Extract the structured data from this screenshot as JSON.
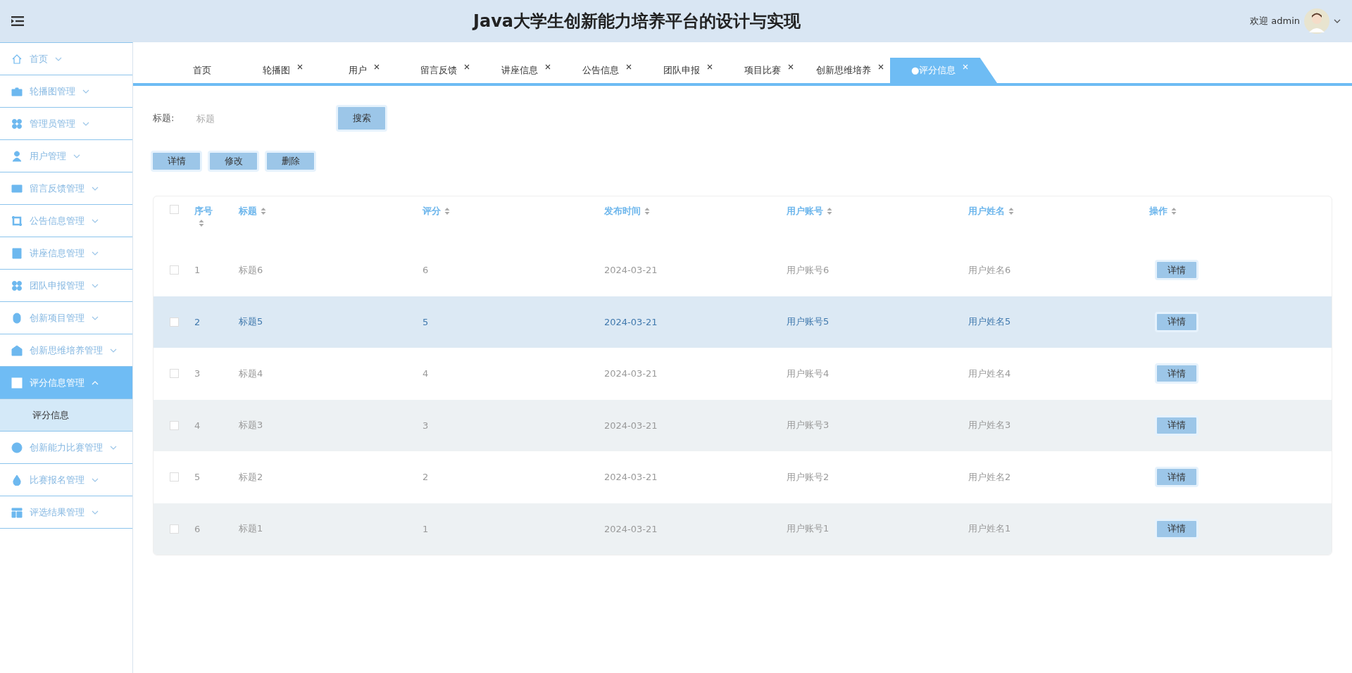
{
  "header": {
    "title": "Java大学生创新能力培养平台的设计与实现",
    "welcome": "欢迎 admin"
  },
  "sidebar": {
    "items": [
      {
        "label": "首页",
        "expanded": false,
        "selected": false
      },
      {
        "label": "轮播图管理",
        "expanded": false,
        "selected": false
      },
      {
        "label": "管理员管理",
        "expanded": false,
        "selected": false
      },
      {
        "label": "用户管理",
        "expanded": false,
        "selected": false
      },
      {
        "label": "留言反馈管理",
        "expanded": false,
        "selected": false
      },
      {
        "label": "公告信息管理",
        "expanded": false,
        "selected": false
      },
      {
        "label": "讲座信息管理",
        "expanded": false,
        "selected": false
      },
      {
        "label": "团队申报管理",
        "expanded": false,
        "selected": false
      },
      {
        "label": "创新项目管理",
        "expanded": false,
        "selected": false
      },
      {
        "label": "创新思维培养管理",
        "expanded": false,
        "selected": false
      },
      {
        "label": "评分信息管理",
        "expanded": true,
        "selected": true,
        "children": [
          {
            "label": "评分信息",
            "selected": true
          }
        ]
      },
      {
        "label": "创新能力比赛管理",
        "expanded": false,
        "selected": false
      },
      {
        "label": "比赛报名管理",
        "expanded": false,
        "selected": false
      },
      {
        "label": "评选结果管理",
        "expanded": false,
        "selected": false
      }
    ]
  },
  "tabs": [
    {
      "label": "首页",
      "closable": false,
      "selected": false
    },
    {
      "label": "轮播图",
      "closable": true,
      "selected": false
    },
    {
      "label": "用户",
      "closable": true,
      "selected": false
    },
    {
      "label": "留言反馈",
      "closable": true,
      "selected": false
    },
    {
      "label": "讲座信息",
      "closable": true,
      "selected": false
    },
    {
      "label": "公告信息",
      "closable": true,
      "selected": false
    },
    {
      "label": "团队申报",
      "closable": true,
      "selected": false
    },
    {
      "label": "项目比赛",
      "closable": true,
      "selected": false
    },
    {
      "label": "创新思维培养",
      "closable": true,
      "selected": false
    },
    {
      "label": "●评分信息",
      "closable": true,
      "selected": true
    }
  ],
  "search": {
    "label": "标题:",
    "placeholder": "标题",
    "button": "搜索"
  },
  "actions": [
    "详情",
    "修改",
    "删除"
  ],
  "table": {
    "all_checked": false,
    "columns": [
      "序号",
      "标题",
      "评分",
      "发布时间",
      "用户账号",
      "用户姓名",
      "操作"
    ],
    "rows": [
      {
        "no": "1",
        "title": "标题6",
        "score": "6",
        "time": "2024-03-21",
        "account": "用户账号6",
        "name": "用户姓名6",
        "action": "详情",
        "checked": false,
        "highlighted": false
      },
      {
        "no": "2",
        "title": "标题5",
        "score": "5",
        "time": "2024-03-21",
        "account": "用户账号5",
        "name": "用户姓名5",
        "action": "详情",
        "checked": false,
        "highlighted": true
      },
      {
        "no": "3",
        "title": "标题4",
        "score": "4",
        "time": "2024-03-21",
        "account": "用户账号4",
        "name": "用户姓名4",
        "action": "详情",
        "checked": false,
        "highlighted": false
      },
      {
        "no": "4",
        "title": "标题3",
        "score": "3",
        "time": "2024-03-21",
        "account": "用户账号3",
        "name": "用户姓名3",
        "action": "详情",
        "checked": false,
        "highlighted": false
      },
      {
        "no": "5",
        "title": "标题2",
        "score": "2",
        "time": "2024-03-21",
        "account": "用户账号2",
        "name": "用户姓名2",
        "action": "详情",
        "checked": false,
        "highlighted": false
      },
      {
        "no": "6",
        "title": "标题1",
        "score": "1",
        "time": "2024-03-21",
        "account": "用户账号1",
        "name": "用户姓名1",
        "action": "详情",
        "checked": false,
        "highlighted": false
      }
    ]
  }
}
